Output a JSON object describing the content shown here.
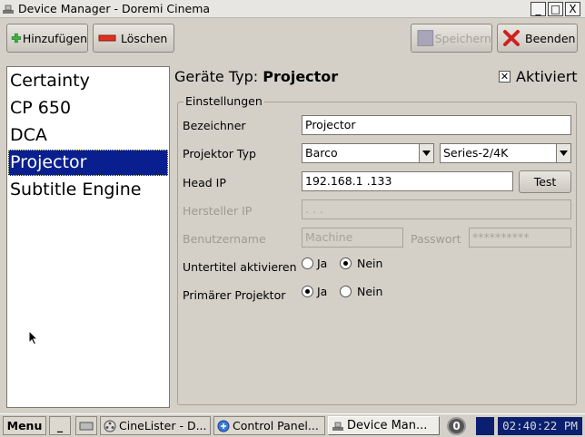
{
  "window": {
    "title": "Device Manager - Doremi Cinema",
    "minimize_label": "_",
    "maximize_label": "□",
    "close_label": "X"
  },
  "toolbar": {
    "add_label": "Hinzufügen",
    "delete_label": "Löschen",
    "save_label": "Speichern",
    "quit_label": "Beenden"
  },
  "devices": [
    "Certainty",
    "CP 650",
    "DCA",
    "Projector",
    "Subtitle Engine"
  ],
  "selected_device": "Projector",
  "header": {
    "type_label": "Geräte Typ:",
    "type_value": "Projector",
    "active_label": "Aktiviert",
    "active_mark": "✕"
  },
  "settings": {
    "legend": "Einstellungen",
    "name_label": "Bezeichner",
    "name_value": "Projector",
    "projector_type_label": "Projektor Typ",
    "projector_brand": "Barco",
    "projector_series": "Series-2/4K",
    "head_ip_label": "Head IP",
    "head_ip_value": "192.168.1  .133",
    "test_label": "Test",
    "vendor_ip_label": "Hersteller IP",
    "vendor_ip_value": "  .   .   .",
    "username_label": "Benutzername",
    "username_placeholder": "Machine",
    "password_label": "Passwort",
    "password_value": "**********",
    "subtitle_label": "Untertitel aktivieren",
    "primary_label": "Primärer Projektor",
    "yes_label": "Ja",
    "no_label": "Nein",
    "subtitle_enabled": false,
    "primary_enabled": true
  },
  "taskbar": {
    "menu_label": "Menu",
    "show_desktop_label": "_",
    "items": [
      "CineLister - D...",
      "Control Panel...",
      "Device Man..."
    ],
    "notify_count": "0",
    "clock": "02:40:22 PM"
  },
  "colors": {
    "selection": "#0a1f8f",
    "clock_bg": "#0a1f6f",
    "add_icon": "#3cb043",
    "delete_icon": "#e03020",
    "quit_icon": "#d02020"
  }
}
